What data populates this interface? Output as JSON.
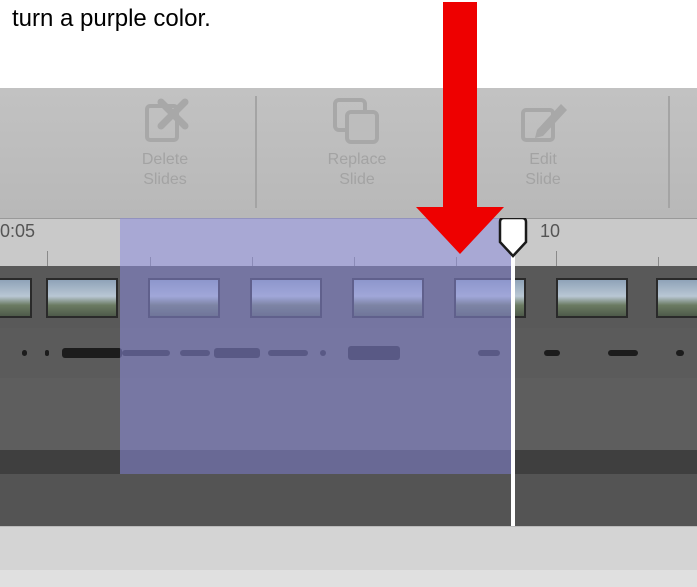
{
  "caption": "turn a purple color.",
  "toolbar": {
    "delete_slides": "Delete\nSlides",
    "replace_slide": "Replace\nSlide",
    "edit_slide": "Edit\nSlide"
  },
  "ruler": {
    "left_label": "0:05",
    "right_label": "10"
  },
  "icons": {
    "delete": "delete-slides-icon",
    "replace": "replace-slide-icon",
    "edit": "edit-slide-icon"
  },
  "colors": {
    "selection": "#8c8cdc",
    "arrow": "#ee0000",
    "playhead": "#ffffff"
  }
}
